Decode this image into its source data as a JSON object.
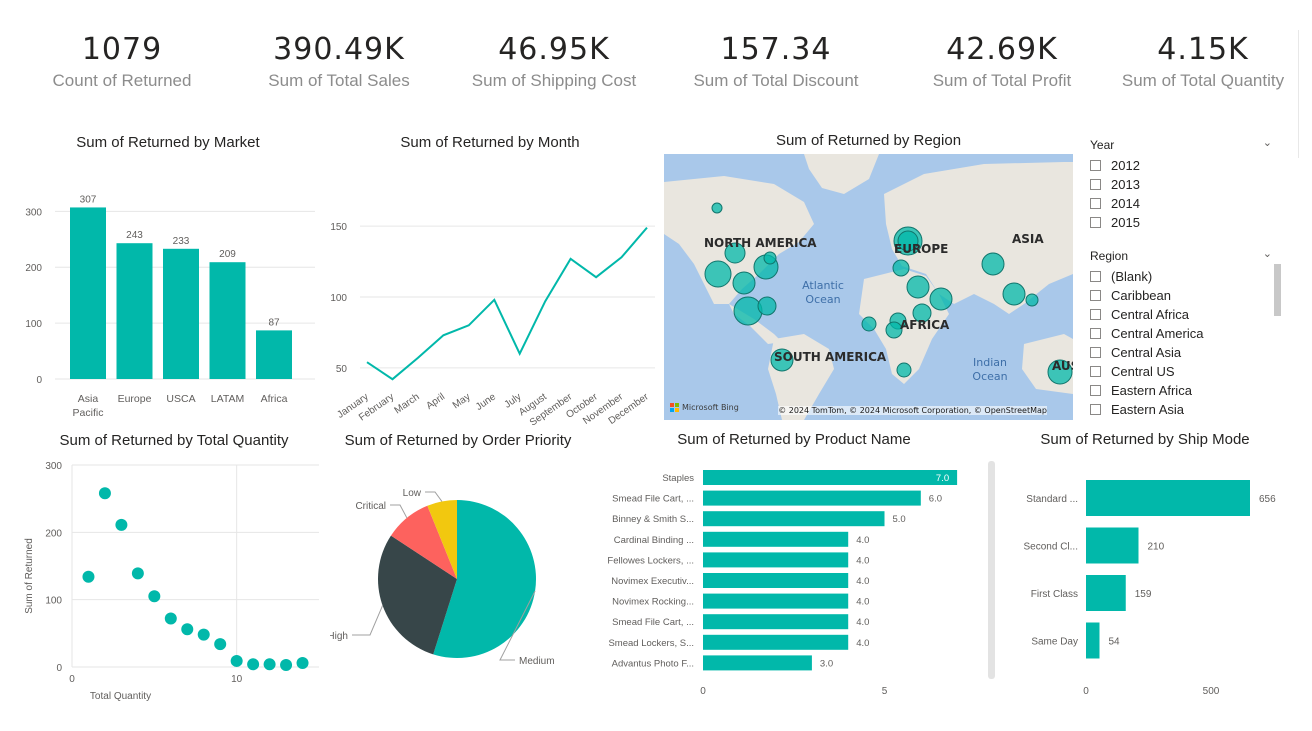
{
  "kpis": [
    {
      "value": "1079",
      "label": "Count of Returned"
    },
    {
      "value": "390.49K",
      "label": "Sum of Total Sales"
    },
    {
      "value": "46.95K",
      "label": "Sum of Shipping Cost"
    },
    {
      "value": "157.34",
      "label": "Sum of Total Discount"
    },
    {
      "value": "42.69K",
      "label": "Sum of Total Profit"
    },
    {
      "value": "4.15K",
      "label": "Sum of Total Quantity"
    }
  ],
  "colors": {
    "accent": "#01b8aa",
    "dark": "#374649",
    "red": "#fd625e",
    "yellow": "#f2c80f",
    "grid": "#e6e6e6",
    "axis": "#605e5c"
  },
  "map": {
    "title": "Sum of Returned by Region",
    "labels": [
      "NORTH AMERICA",
      "EUROPE",
      "ASIA",
      "AFRICA",
      "SOUTH AMERICA",
      "AUS"
    ],
    "ocean_labels": [
      "Atlantic Ocean",
      "Indian Ocean"
    ],
    "logo": "Microsoft Bing",
    "copyright": "© 2024 TomTom, © 2024 Microsoft Corporation, © OpenStreetMap"
  },
  "slicers": {
    "year": {
      "title": "Year",
      "items": [
        "2012",
        "2013",
        "2014",
        "2015"
      ]
    },
    "region": {
      "title": "Region",
      "items": [
        "(Blank)",
        "Caribbean",
        "Central Africa",
        "Central America",
        "Central Asia",
        "Central US",
        "Eastern Africa",
        "Eastern Asia"
      ]
    }
  },
  "chart_data": [
    {
      "id": "market",
      "type": "bar",
      "title": "Sum of Returned by Market",
      "categories": [
        "Asia Pacific",
        "Europe",
        "USCA",
        "LATAM",
        "Africa"
      ],
      "values": [
        307,
        243,
        233,
        209,
        87
      ],
      "yticks": [
        0,
        100,
        200,
        300
      ],
      "ylim": [
        0,
        340
      ]
    },
    {
      "id": "month",
      "type": "line",
      "title": "Sum of Returned by Month",
      "categories": [
        "January",
        "February",
        "March",
        "April",
        "May",
        "June",
        "July",
        "August",
        "September",
        "October",
        "November",
        "December"
      ],
      "values": [
        54,
        42,
        57,
        73,
        80,
        98,
        60,
        97,
        127,
        114,
        128,
        149
      ],
      "yticks": [
        50,
        100,
        150
      ],
      "ylim": [
        40,
        160
      ]
    },
    {
      "id": "quantity",
      "type": "scatter",
      "title": "Sum of Returned by Total Quantity",
      "xlabel": "Total Quantity",
      "ylabel": "Sum of Returned",
      "x": [
        1,
        2,
        3,
        4,
        5,
        6,
        7,
        8,
        9,
        10,
        11,
        12,
        13,
        14
      ],
      "y": [
        134,
        258,
        211,
        139,
        105,
        72,
        56,
        48,
        34,
        9,
        4,
        4,
        3,
        6
      ],
      "xticks": [
        0,
        10
      ],
      "yticks": [
        0,
        100,
        200,
        300
      ],
      "xlim": [
        0,
        15
      ],
      "ylim": [
        0,
        300
      ]
    },
    {
      "id": "priority",
      "type": "pie",
      "title": "Sum of Returned by Order Priority",
      "categories": [
        "Medium",
        "High",
        "Critical",
        "Low"
      ],
      "values": [
        592,
        317,
        104,
        66
      ]
    },
    {
      "id": "product",
      "type": "bar",
      "orientation": "horizontal",
      "title": "Sum of Returned by Product Name",
      "categories": [
        "Staples",
        "Smead File Cart, ...",
        "Binney & Smith S...",
        "Cardinal Binding ...",
        "Fellowes Lockers, ...",
        "Novimex Executiv...",
        "Novimex Rocking...",
        "Smead File Cart, ...",
        "Smead Lockers, S...",
        "Advantus Photo F..."
      ],
      "values": [
        7.0,
        6.0,
        5.0,
        4.0,
        4.0,
        4.0,
        4.0,
        4.0,
        4.0,
        3.0
      ],
      "labels": [
        "7.0",
        "6.0",
        "5.0",
        "4.0",
        "4.0",
        "4.0",
        "4.0",
        "4.0",
        "4.0",
        "3.0"
      ],
      "xticks": [
        0,
        5
      ],
      "xlim": [
        0,
        7.3
      ]
    },
    {
      "id": "shipmode",
      "type": "bar",
      "orientation": "horizontal",
      "title": "Sum of Returned by Ship Mode",
      "categories": [
        "Standard ...",
        "Second Cl...",
        "First Class",
        "Same Day"
      ],
      "values": [
        656,
        210,
        159,
        54
      ],
      "xticks": [
        0,
        500
      ],
      "xlim": [
        0,
        700
      ]
    }
  ]
}
